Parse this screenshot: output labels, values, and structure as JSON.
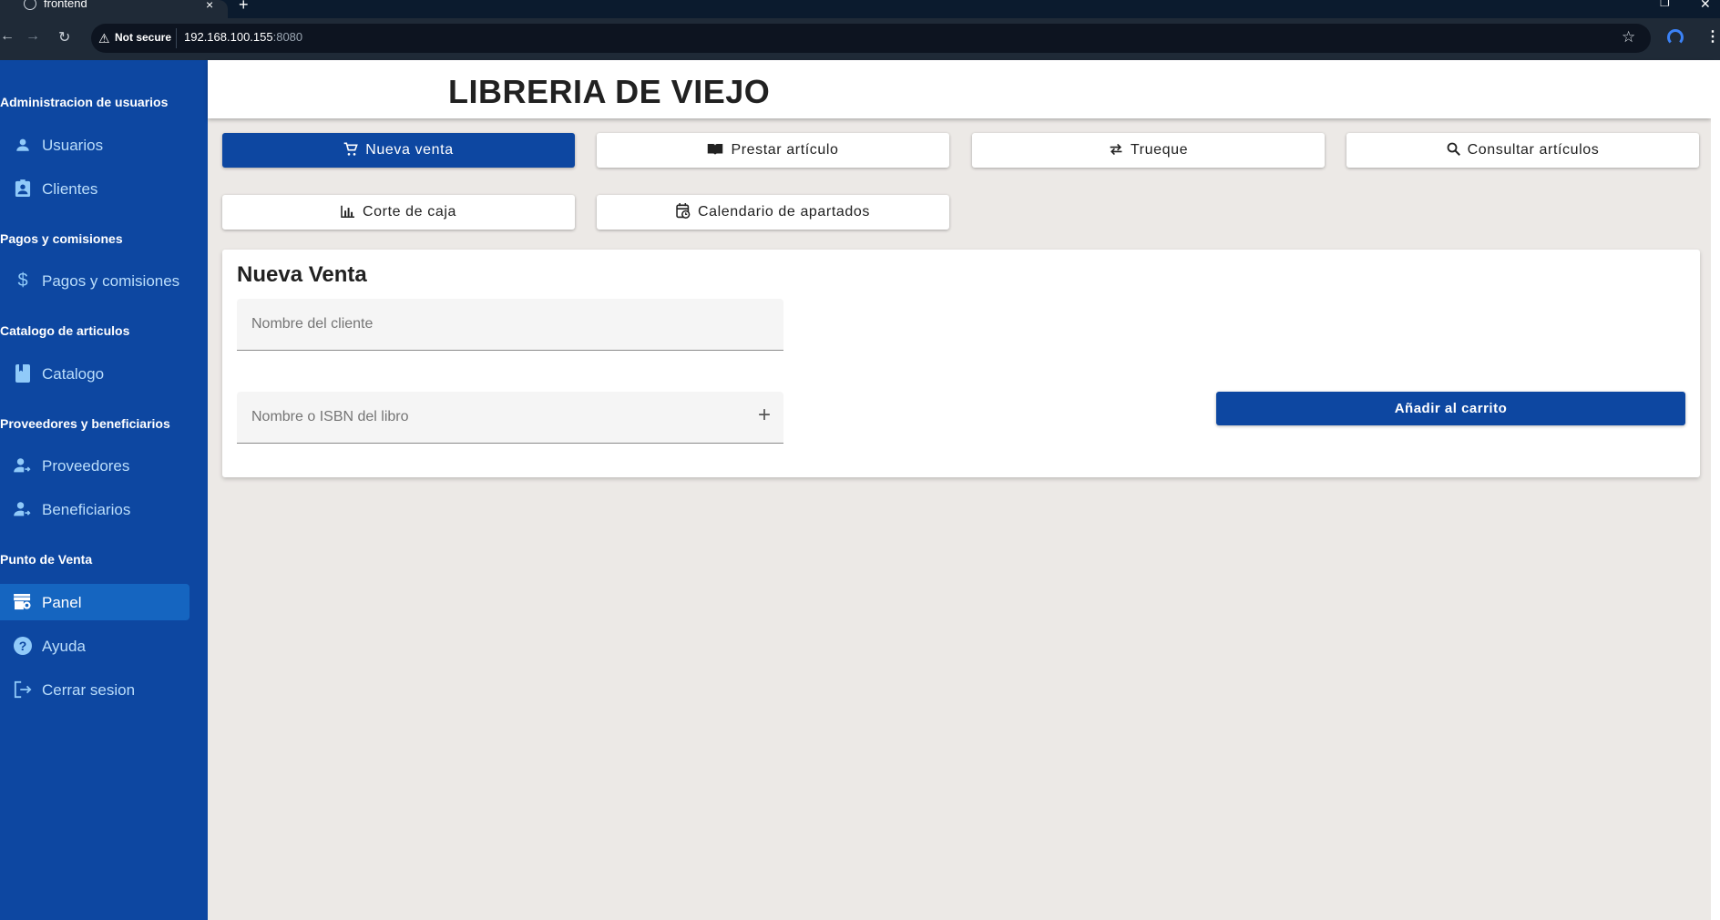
{
  "browser": {
    "tab_title": "frontend",
    "tab_close": "×",
    "new_tab": "+",
    "security_label": "Not secure",
    "url_host": "192.168.100.155",
    "url_port": ":8080"
  },
  "app": {
    "title": "LIBRERIA DE VIEJO",
    "brand_color": "#0d47a1"
  },
  "sidebar": {
    "sections": [
      {
        "title": "Administracion de usuarios",
        "items": [
          {
            "label": "Usuarios",
            "icon": "person-icon"
          },
          {
            "label": "Clientes",
            "icon": "contact-card-icon"
          }
        ]
      },
      {
        "title": "Pagos y comisiones",
        "items": [
          {
            "label": "Pagos y comisiones",
            "icon": "dollar-icon"
          }
        ]
      },
      {
        "title": "Catalogo de articulos",
        "items": [
          {
            "label": "Catalogo",
            "icon": "book-icon"
          }
        ]
      },
      {
        "title": "Proveedores y beneficiarios",
        "items": [
          {
            "label": "Proveedores",
            "icon": "person-arrow-icon"
          },
          {
            "label": "Beneficiarios",
            "icon": "person-arrow-icon"
          }
        ]
      },
      {
        "title": "Punto de Venta",
        "items": [
          {
            "label": "Panel",
            "icon": "store-icon",
            "active": true
          },
          {
            "label": "Ayuda",
            "icon": "help-icon"
          },
          {
            "label": "Cerrar sesion",
            "icon": "logout-icon"
          }
        ]
      }
    ]
  },
  "actions": [
    {
      "label": "Nueva venta",
      "icon": "cart-icon",
      "active": true
    },
    {
      "label": "Prestar artículo",
      "icon": "open-book-icon"
    },
    {
      "label": "Trueque",
      "icon": "swap-icon"
    },
    {
      "label": "Consultar artículos",
      "icon": "search-icon"
    },
    {
      "label": "Corte de caja",
      "icon": "bar-chart-icon"
    },
    {
      "label": "Calendario de apartados",
      "icon": "calendar-clock-icon"
    }
  ],
  "sale": {
    "title": "Nueva Venta",
    "client_placeholder": "Nombre del cliente",
    "book_placeholder": "Nombre o ISBN del libro",
    "add_to_cart": "Añadir al carrito"
  }
}
